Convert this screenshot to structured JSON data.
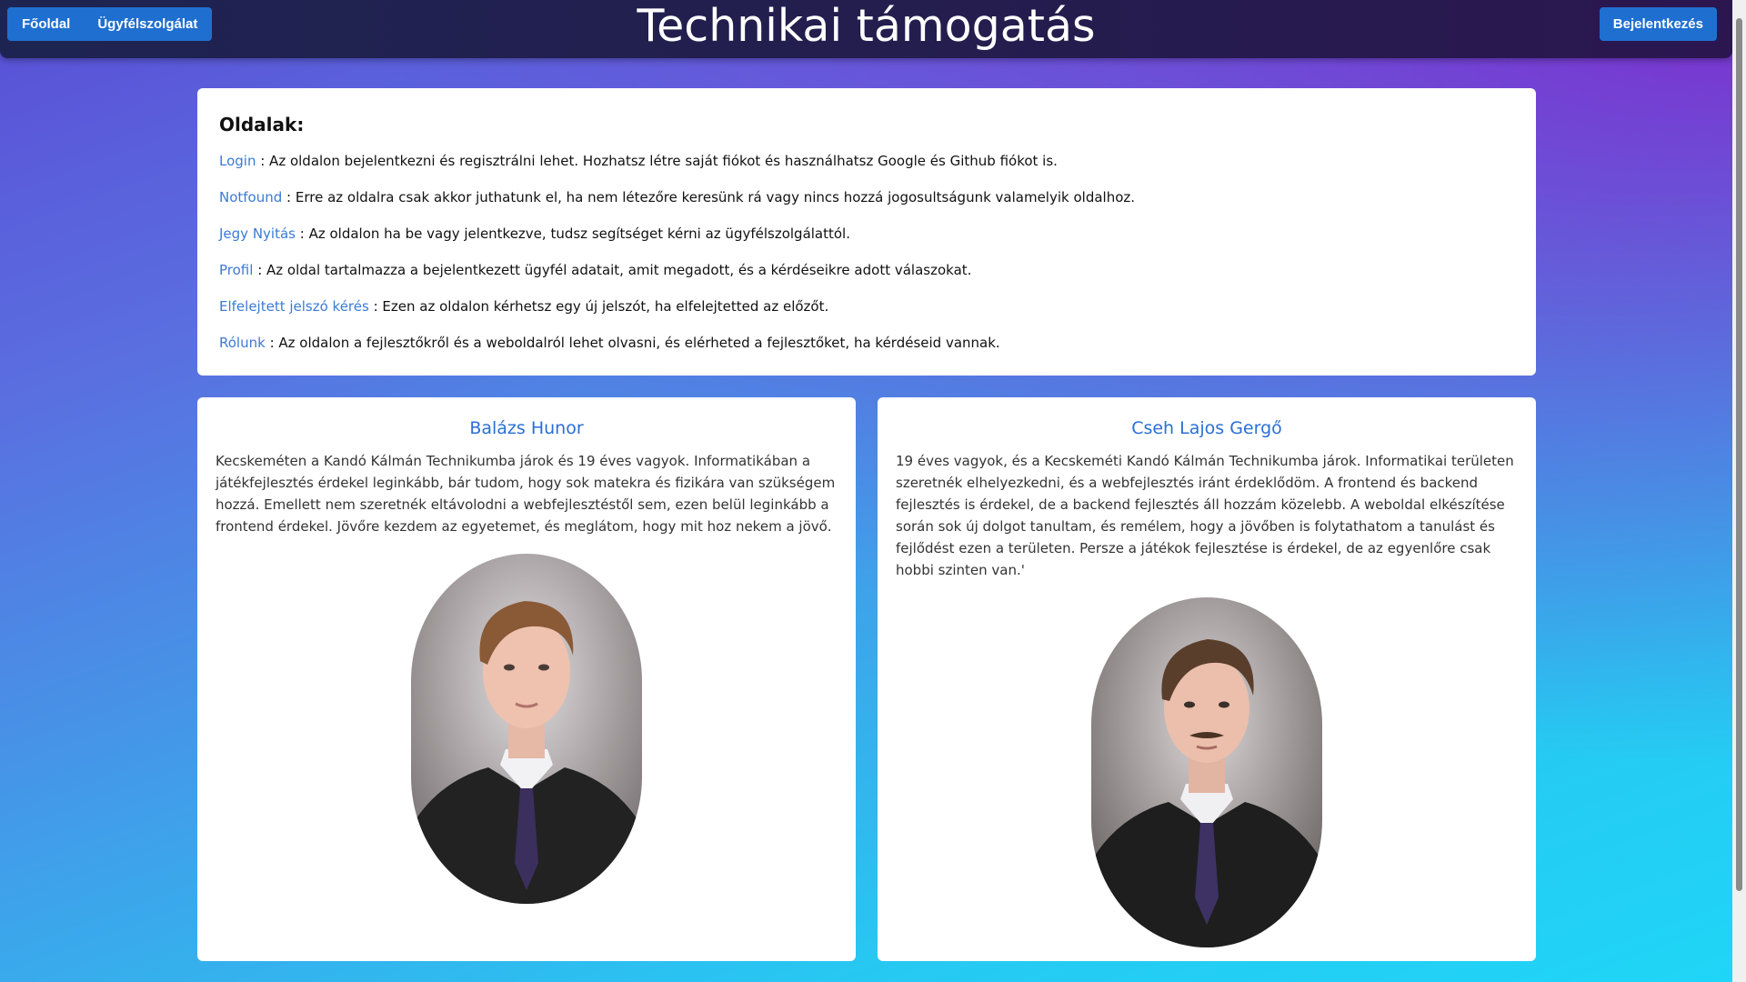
{
  "navbar": {
    "home_label": "Főoldal",
    "support_label": "Ügyfélszolgálat",
    "title": "Technikai támogatás",
    "login_label": "Bejelentkezés"
  },
  "pages": {
    "heading": "Oldalak:",
    "items": [
      {
        "link": "Login",
        "text": " : Az oldalon bejelentkezni és regisztrálni lehet. Hozhatsz létre saját fiókot és használhatsz Google és Github fiókot is."
      },
      {
        "link": "Notfound",
        "text": " : Erre az oldalra csak akkor juthatunk el, ha nem létezőre keresünk rá vagy nincs hozzá jogosultságunk valamelyik oldalhoz."
      },
      {
        "link": "Jegy Nyitás",
        "text": " : Az oldalon ha be vagy jelentkezve, tudsz segítséget kérni az ügyfélszolgálattól."
      },
      {
        "link": "Profil",
        "text": " : Az oldal tartalmazza a bejelentkezett ügyfél adatait, amit megadott, és a kérdéseikre adott válaszokat."
      },
      {
        "link": "Elfelejtett jelszó kérés",
        "text": " : Ezen az oldalon kérhetsz egy új jelszót, ha elfelejtetted az előzőt."
      },
      {
        "link": "Rólunk",
        "text": " : Az oldalon a fejlesztőkről és a weboldalról lehet olvasni, és elérheted a fejlesztőket, ha kérdéseid vannak."
      }
    ]
  },
  "developers": [
    {
      "name": "Balázs Hunor",
      "bio": "Kecskeméten a Kandó Kálmán Technikumba járok és 19 éves vagyok. Informatikában a játékfejlesztés érdekel leginkább, bár tudom, hogy sok matekra és fizikára van szükségem hozzá. Emellett nem szeretnék eltávolodni a webfejlesztéstől sem, ezen belül leginkább a frontend érdekel. Jövőre kezdem az egyetemet, és meglátom, hogy mit hoz nekem a jövő."
    },
    {
      "name": "Cseh Lajos Gergő",
      "bio": "19 éves vagyok, és a Kecskeméti Kandó Kálmán Technikumba járok. Informatikai területen szeretnék elhelyezkedni, és a webfejlesztés iránt érdeklődöm. A frontend és backend fejlesztés is érdekel, de a backend fejlesztés áll hozzám közelebb. A weboldal elkészítése során sok új dolgot tanultam, és remélem, hogy a jövőben is folytathatom a tanulást és fejlődést ezen a területen. Persze a játékok fejlesztése is érdekel, de az egyenlőre csak hobbi szinten van.'"
    }
  ],
  "colors": {
    "nav_button": "#1f6fd0",
    "link": "#3a7bd5",
    "dev_name": "#2a6fd6"
  }
}
